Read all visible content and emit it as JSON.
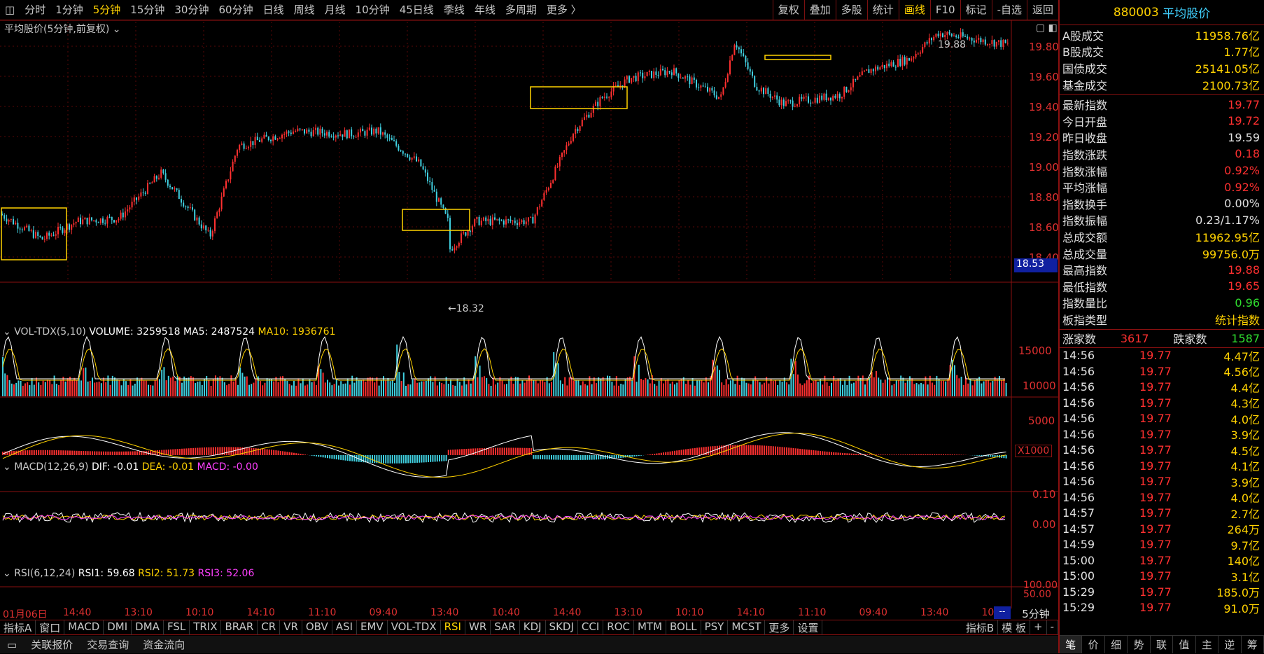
{
  "toolbar": {
    "periods": [
      "分时",
      "1分钟",
      "5分钟",
      "15分钟",
      "30分钟",
      "60分钟",
      "日线",
      "周线",
      "月线",
      "10分钟",
      "45日线",
      "季线",
      "年线",
      "多周期",
      "更多 〉"
    ],
    "selected_index": 2,
    "right": [
      "复权",
      "叠加",
      "多股",
      "统计",
      "画线",
      "F10",
      "标记",
      "-自选",
      "返回"
    ],
    "right_active_index": 4
  },
  "main_chart": {
    "title": "平均股价(5分钟,前复权)",
    "y_labels": [
      "19.80",
      "19.60",
      "19.40",
      "19.20",
      "19.00",
      "18.80",
      "18.60",
      "18.40"
    ],
    "current_price": "18.53",
    "high_marker": "19.88",
    "low_marker": "←18.32"
  },
  "vol_chart": {
    "name": "VOL-TDX(5,10)",
    "volume_label": "VOLUME: 3259518",
    "ma5_label": "MA5: 2487524",
    "ma10_label": "MA10: 1936761",
    "y_labels": [
      "15000",
      "10000",
      "5000"
    ],
    "unit": "X1000"
  },
  "macd_chart": {
    "name": "MACD(12,26,9)",
    "dif": "DIF: -0.01",
    "dea": "DEA: -0.01",
    "macd": "MACD: -0.00",
    "y_labels": [
      "0.10",
      "0.00"
    ]
  },
  "rsi_chart": {
    "name": "RSI(6,12,24)",
    "rsi1": "RSI1: 59.68",
    "rsi2": "RSI2: 51.73",
    "rsi3": "RSI3: 52.06",
    "y_labels": [
      "100.00",
      "50.00"
    ]
  },
  "time_axis": {
    "labels": [
      "01月06日",
      "14:40",
      "13:10",
      "10:10",
      "14:10",
      "11:10",
      "09:40",
      "13:40",
      "10:40",
      "14:40",
      "13:10",
      "10:10",
      "14:10",
      "11:10",
      "09:40",
      "13:40",
      "10:40"
    ],
    "period": "5分钟"
  },
  "indicator_bar": [
    "指标A",
    "窗口",
    "MACD",
    "DMI",
    "DMA",
    "FSL",
    "TRIX",
    "BRAR",
    "CR",
    "VR",
    "OBV",
    "ASI",
    "EMV",
    "VOL-TDX",
    "RSI",
    "WR",
    "SAR",
    "KDJ",
    "SKDJ",
    "CCI",
    "ROC",
    "MTM",
    "BOLL",
    "PSY",
    "MCST",
    "更多",
    "设置"
  ],
  "indicator_active": "RSI",
  "indicator_right": [
    "指标B",
    "模 板",
    "+",
    "-"
  ],
  "footer": [
    "关联报价",
    "交易查询",
    "资金流向"
  ],
  "sidebar": {
    "code": "880003",
    "name": "平均股价",
    "rows1": [
      [
        "A股成交",
        "11958.76亿",
        "yel"
      ],
      [
        "B股成交",
        "1.77亿",
        "yel"
      ],
      [
        "国债成交",
        "25141.05亿",
        "yel"
      ],
      [
        "基金成交",
        "2100.73亿",
        "yel"
      ]
    ],
    "rows2": [
      [
        "最新指数",
        "19.77",
        "red"
      ],
      [
        "今日开盘",
        "19.72",
        "red"
      ],
      [
        "昨日收盘",
        "19.59",
        "wht"
      ],
      [
        "指数涨跌",
        "0.18",
        "red"
      ],
      [
        "指数涨幅",
        "0.92%",
        "red"
      ],
      [
        "平均涨幅",
        "0.92%",
        "red"
      ],
      [
        "指数换手",
        "0.00%",
        "wht"
      ],
      [
        "指数振幅",
        "0.23/1.17%",
        "wht"
      ],
      [
        "总成交额",
        "11962.95亿",
        "yel"
      ],
      [
        "总成交量",
        "99756.0万",
        "yel"
      ],
      [
        "最高指数",
        "19.88",
        "red"
      ],
      [
        "最低指数",
        "19.65",
        "red"
      ],
      [
        "指数量比",
        "0.96",
        "grn"
      ],
      [
        "板指类型",
        "统计指数",
        "yel"
      ]
    ],
    "up_label": "涨家数",
    "up_value": "3617",
    "down_label": "跌家数",
    "down_value": "1587",
    "ticks": [
      [
        "14:56",
        "19.77",
        "4.47亿"
      ],
      [
        "14:56",
        "19.77",
        "4.56亿"
      ],
      [
        "14:56",
        "19.77",
        "4.4亿"
      ],
      [
        "14:56",
        "19.77",
        "4.3亿"
      ],
      [
        "14:56",
        "19.77",
        "4.0亿"
      ],
      [
        "14:56",
        "19.77",
        "3.9亿"
      ],
      [
        "14:56",
        "19.77",
        "4.5亿"
      ],
      [
        "14:56",
        "19.77",
        "4.1亿"
      ],
      [
        "14:56",
        "19.77",
        "3.9亿"
      ],
      [
        "14:56",
        "19.77",
        "4.0亿"
      ],
      [
        "14:57",
        "19.77",
        "2.7亿"
      ],
      [
        "14:57",
        "19.77",
        "264万"
      ],
      [
        "14:59",
        "19.77",
        "9.7亿"
      ],
      [
        "15:00",
        "19.77",
        "140亿"
      ],
      [
        "15:00",
        "19.77",
        "3.1亿"
      ],
      [
        "15:29",
        "19.77",
        "185.0万"
      ],
      [
        "15:29",
        "19.77",
        "91.0万"
      ]
    ],
    "tabs": [
      "笔",
      "价",
      "细",
      "势",
      "联",
      "值",
      "主",
      "逆",
      "筹"
    ]
  },
  "colors": {
    "up": "#ff3030",
    "down": "#40d0e0",
    "ma_white": "#ffffff",
    "ma_yellow": "#ffd200",
    "ma_purple": "#ff40ff",
    "grid": "#8a1010"
  }
}
